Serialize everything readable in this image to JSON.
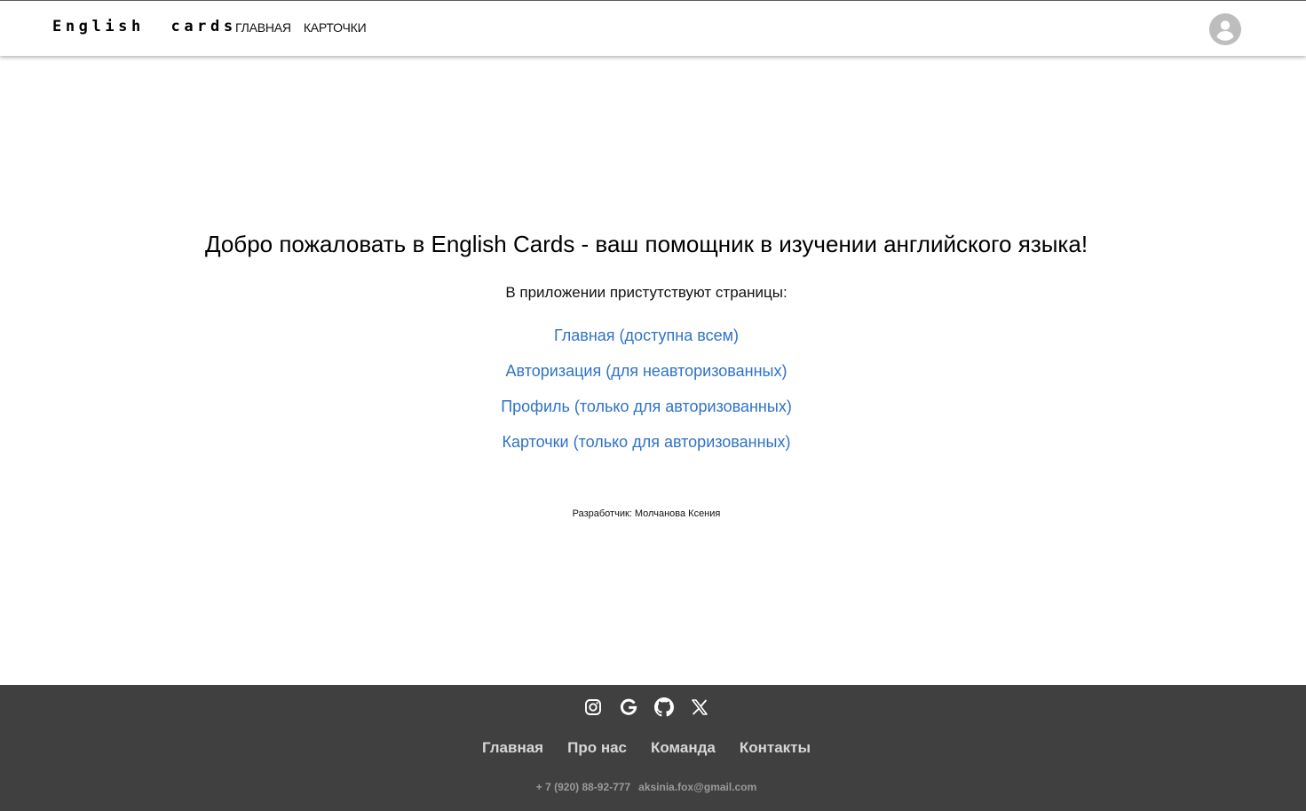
{
  "header": {
    "logo": "English  cards",
    "nav": [
      {
        "label": "Главная"
      },
      {
        "label": "Карточки"
      }
    ],
    "avatar_icon": "account-circle-icon"
  },
  "main": {
    "title": "Добро пожаловать в English Cards - ваш помощник в изучении английского языка!",
    "pages_intro": "В приложении пристутствуют страницы:",
    "page_links": [
      {
        "label": "Главная (доступна всем)"
      },
      {
        "label": "Авторизация (для неавторизованных)"
      },
      {
        "label": "Профиль (только для авторизованных)"
      },
      {
        "label": "Карточки (только для авторизованных)"
      }
    ],
    "developer": "Разработчик: Молчанова Ксения"
  },
  "footer": {
    "socials": [
      "instagram-icon",
      "google-icon",
      "github-icon",
      "x-twitter-icon"
    ],
    "links": [
      {
        "label": "Главная"
      },
      {
        "label": "Про нас"
      },
      {
        "label": "Команда"
      },
      {
        "label": "Контакты"
      }
    ],
    "phone": "+ 7 (920) 88-92-777",
    "email": "aksinia.fox@gmail.com"
  },
  "colors": {
    "link": "#2f73c5",
    "footer_bg": "#404040",
    "avatar": "#bdbdbd"
  }
}
